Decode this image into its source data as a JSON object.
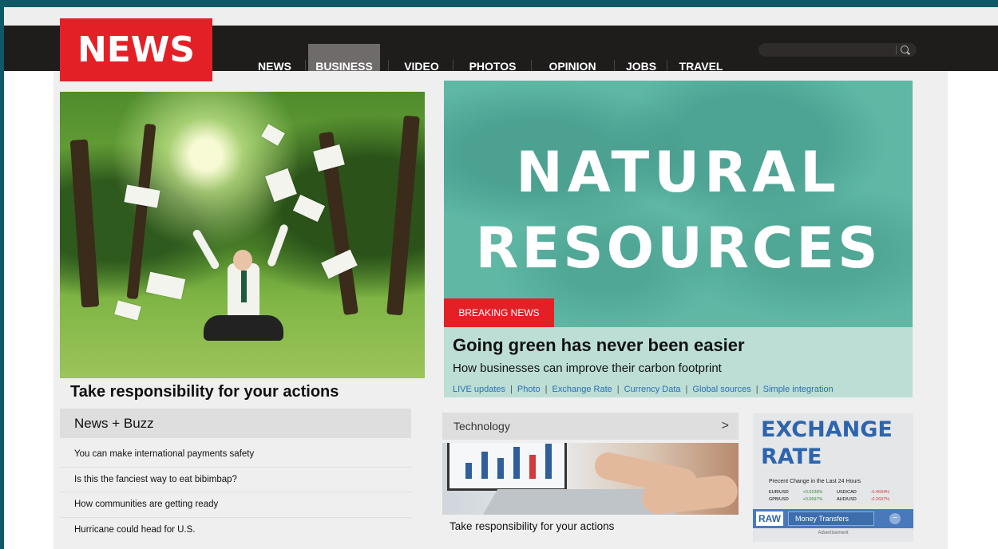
{
  "header": {
    "logo": "NEWS",
    "nav": [
      {
        "label": "NEWS",
        "active": false
      },
      {
        "label": "BUSINESS",
        "active": true
      },
      {
        "label": "VIDEO",
        "active": false
      },
      {
        "label": "PHOTOS",
        "active": false
      },
      {
        "label": "OPINION",
        "active": false
      },
      {
        "label": "JOBS",
        "active": false
      },
      {
        "label": "TRAVEL",
        "active": false
      }
    ],
    "search_placeholder": ""
  },
  "feature_left": {
    "caption": "Take responsibility for your actions"
  },
  "feature_right": {
    "headline_line1": "NATURAL",
    "headline_line2": "RESOURCES",
    "badge": "BREAKING NEWS",
    "title": "Going green has never been easier",
    "subtitle": "How businesses can improve their carbon footprint",
    "links": [
      "LIVE updates",
      "Photo",
      "Exchange Rate",
      "Currency Data",
      "Global sources",
      "Simple integration"
    ]
  },
  "buzz": {
    "title": "News + Buzz",
    "items": [
      "You can make international payments safety",
      "Is this the fanciest way to eat bibimbap?",
      "How communities are getting ready",
      "Hurricane could head for U.S."
    ]
  },
  "technology": {
    "title": "Technology",
    "chevron": ">",
    "caption": "Take responsibility for your actions"
  },
  "exchange": {
    "title_line1": "EXCHANGE",
    "title_line2": "RATE",
    "description": "Precent Change in the Last 24 Hours",
    "rows": [
      [
        "EUR/USD",
        "+0.0238%",
        "USD/CAD",
        "-0.4694%"
      ],
      [
        "GPB/USD",
        "+0.0697%",
        "AUD/USD",
        "-0.2697%"
      ]
    ],
    "raw_label": "RAW",
    "button_label": "Money Transfers",
    "toggle": "−",
    "advert": "Advertisement"
  },
  "colors": {
    "brand_red": "#e42027",
    "nav_bg": "#1f1c1c",
    "teal": "#5fb7a4",
    "link_blue": "#2b6fb5",
    "exchange_blue": "#2d64ae"
  }
}
